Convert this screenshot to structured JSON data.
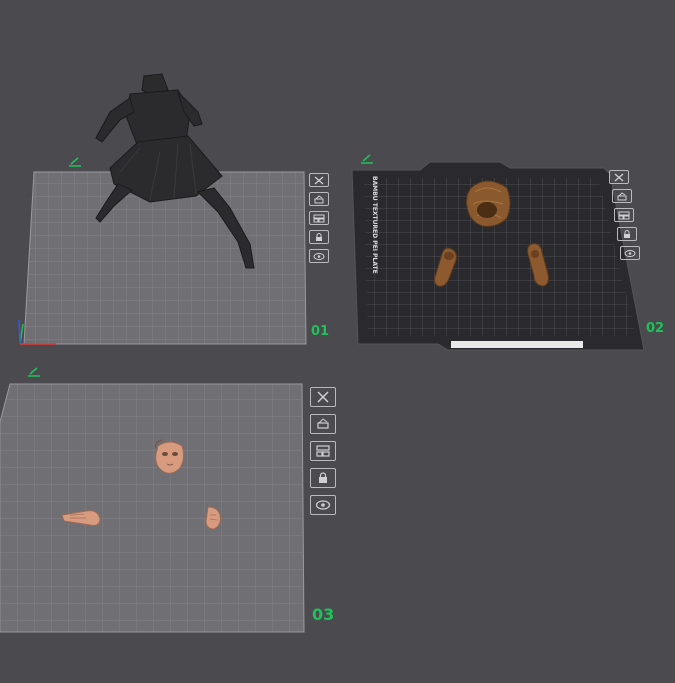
{
  "plates": [
    {
      "label": "01",
      "style": "generic-grid",
      "models": [
        "dark figure body"
      ]
    },
    {
      "label": "02",
      "style": "textured-pei-bed",
      "bed_text": "BAMBU TEXTURED PEI PLATE",
      "models": [
        "hair",
        "shoe",
        "shoe"
      ]
    },
    {
      "label": "03",
      "style": "generic-grid",
      "models": [
        "head",
        "hand",
        "hand"
      ]
    }
  ],
  "plate_tools": [
    {
      "name": "close-icon",
      "interactable": true
    },
    {
      "name": "auto-orient-icon",
      "interactable": true
    },
    {
      "name": "arrange-icon",
      "interactable": true
    },
    {
      "name": "lock-icon",
      "interactable": true
    },
    {
      "name": "eye-icon",
      "interactable": true
    }
  ],
  "colors": {
    "background": "#4a4a4f",
    "plate_grid": "#6f6f74",
    "pei_bed": "#2a2a2e",
    "label_green": "#1fc25a",
    "figure": "#2b2b2d",
    "hair": "#8a5a2e",
    "skin": "#d79b80"
  }
}
